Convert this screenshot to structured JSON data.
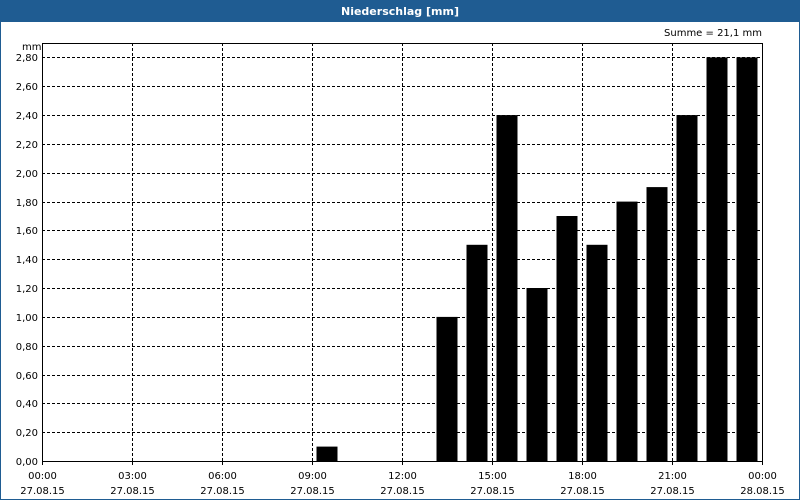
{
  "title": "Niederschlag [mm]",
  "summary": "Summe = 21,1 mm",
  "chart_data": {
    "type": "bar",
    "title": "Niederschlag [mm]",
    "ylabel": "mm",
    "xlabel": "",
    "ylim": [
      0,
      2.9
    ],
    "yticks": [
      0,
      0.2,
      0.4,
      0.6,
      0.8,
      1.0,
      1.2,
      1.4,
      1.6,
      1.8,
      2.0,
      2.2,
      2.4,
      2.6,
      2.8
    ],
    "ytick_labels": [
      "0,00",
      "0,20",
      "0,40",
      "0,60",
      "0,80",
      "1,00",
      "1,20",
      "1,40",
      "1,60",
      "1,80",
      "2,00",
      "2,20",
      "2,40",
      "2,60",
      "2,80"
    ],
    "xlim": [
      "27.08.15 00:00",
      "28.08.15 00:00"
    ],
    "xticks": [
      {
        "time": "00:00",
        "date": "27.08.15"
      },
      {
        "time": "03:00",
        "date": "27.08.15"
      },
      {
        "time": "06:00",
        "date": "27.08.15"
      },
      {
        "time": "09:00",
        "date": "27.08.15"
      },
      {
        "time": "12:00",
        "date": "27.08.15"
      },
      {
        "time": "15:00",
        "date": "27.08.15"
      },
      {
        "time": "18:00",
        "date": "27.08.15"
      },
      {
        "time": "21:00",
        "date": "27.08.15"
      },
      {
        "time": "00:00",
        "date": "28.08.15"
      }
    ],
    "grid": true,
    "bar_color": "#000000",
    "bars": [
      {
        "x": "27.08.15 09:00",
        "value": 0.1
      },
      {
        "x": "27.08.15 13:00",
        "value": 1.0
      },
      {
        "x": "27.08.15 14:00",
        "value": 1.5
      },
      {
        "x": "27.08.15 15:00",
        "value": 2.4
      },
      {
        "x": "27.08.15 16:00",
        "value": 1.2
      },
      {
        "x": "27.08.15 17:00",
        "value": 1.7
      },
      {
        "x": "27.08.15 18:00",
        "value": 1.5
      },
      {
        "x": "27.08.15 19:00",
        "value": 1.8
      },
      {
        "x": "27.08.15 20:00",
        "value": 1.9
      },
      {
        "x": "27.08.15 21:00",
        "value": 2.4
      },
      {
        "x": "27.08.15 22:00",
        "value": 2.8
      },
      {
        "x": "27.08.15 23:00",
        "value": 2.8
      }
    ]
  }
}
